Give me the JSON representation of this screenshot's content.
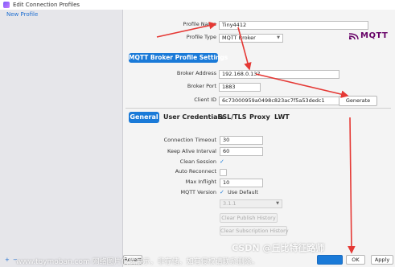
{
  "window": {
    "title": "Edit Connection Profiles"
  },
  "sidebar": {
    "items": [
      {
        "label": "New Profile"
      }
    ],
    "add_label": "+",
    "remove_label": "−"
  },
  "profile": {
    "name_label": "Profile Name",
    "name_value": "Tiny4412",
    "type_label": "Profile Type",
    "type_value": "MQTT Broker",
    "logo_text": "MQTT"
  },
  "broker_section": {
    "header": "MQTT Broker Profile Settings",
    "address_label": "Broker Address",
    "address_value": "192.168.0.137",
    "port_label": "Broker Port",
    "port_value": "1883",
    "client_id_label": "Client ID",
    "client_id_value": "6c73000959a0498c823ac7f5a53dedc1",
    "generate_label": "Generate"
  },
  "tabs": [
    {
      "label": "General",
      "active": true
    },
    {
      "label": "User Credentials",
      "active": false
    },
    {
      "label": "SSL/TLS",
      "active": false
    },
    {
      "label": "Proxy",
      "active": false
    },
    {
      "label": "LWT",
      "active": false
    }
  ],
  "general": {
    "timeout_label": "Connection Timeout",
    "timeout_value": "30",
    "keepalive_label": "Keep Alive Interval",
    "keepalive_value": "60",
    "clean_label": "Clean Session",
    "clean_checked": true,
    "reconnect_label": "Auto Reconnect",
    "reconnect_checked": false,
    "inflight_label": "Max Inflight",
    "inflight_value": "10",
    "mqtt_version_label": "MQTT Version",
    "use_default_label": "Use Default",
    "use_default_checked": true,
    "version_value": "3.1.1",
    "clear_publish_label": "Clear Publish History",
    "clear_subscription_label": "Clear Subscription History"
  },
  "footer": {
    "revert_label": "Revert",
    "ok_label": "OK",
    "apply_label": "Apply"
  },
  "watermarks": {
    "csdn": "CSDN @丘比特征路师",
    "toymoban": "www.toymoban.com 网络图片仅供展示，非存储，如有侵权请联系删除。"
  },
  "colors": {
    "accent": "#1a7ad8",
    "annotation_arrow": "#e53935",
    "mqtt_logo": "#660066"
  }
}
